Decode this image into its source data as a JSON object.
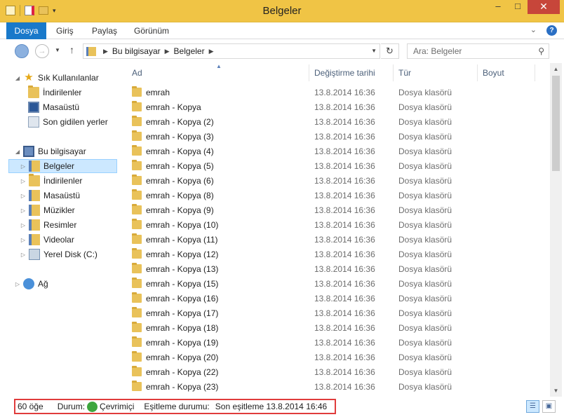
{
  "window": {
    "title": "Belgeler",
    "minimize": "–",
    "maximize": "□",
    "close": "✕"
  },
  "ribbon": {
    "tabs": [
      "Dosya",
      "Giriş",
      "Paylaş",
      "Görünüm"
    ]
  },
  "address": {
    "crumbs": [
      "Bu bilgisayar",
      "Belgeler"
    ],
    "search_placeholder": "Ara: Belgeler"
  },
  "nav": {
    "favorites_label": "Sık Kullanılanlar",
    "favorites": [
      "İndirilenler",
      "Masaüstü",
      "Son gidilen yerler"
    ],
    "pc_label": "Bu bilgisayar",
    "pc_items": [
      "Belgeler",
      "İndirilenler",
      "Masaüstü",
      "Müzikler",
      "Resimler",
      "Videolar",
      "Yerel Disk (C:)"
    ],
    "network_label": "Ağ",
    "selected": "Belgeler"
  },
  "columns": {
    "name": "Ad",
    "date": "Değiştirme tarihi",
    "type": "Tür",
    "size": "Boyut"
  },
  "files": [
    {
      "name": "emrah",
      "date": "13.8.2014 16:36",
      "type": "Dosya klasörü"
    },
    {
      "name": "emrah - Kopya",
      "date": "13.8.2014 16:36",
      "type": "Dosya klasörü"
    },
    {
      "name": "emrah - Kopya (2)",
      "date": "13.8.2014 16:36",
      "type": "Dosya klasörü"
    },
    {
      "name": "emrah - Kopya (3)",
      "date": "13.8.2014 16:36",
      "type": "Dosya klasörü"
    },
    {
      "name": "emrah - Kopya (4)",
      "date": "13.8.2014 16:36",
      "type": "Dosya klasörü"
    },
    {
      "name": "emrah - Kopya (5)",
      "date": "13.8.2014 16:36",
      "type": "Dosya klasörü"
    },
    {
      "name": "emrah - Kopya (6)",
      "date": "13.8.2014 16:36",
      "type": "Dosya klasörü"
    },
    {
      "name": "emrah - Kopya (8)",
      "date": "13.8.2014 16:36",
      "type": "Dosya klasörü"
    },
    {
      "name": "emrah - Kopya (9)",
      "date": "13.8.2014 16:36",
      "type": "Dosya klasörü"
    },
    {
      "name": "emrah - Kopya (10)",
      "date": "13.8.2014 16:36",
      "type": "Dosya klasörü"
    },
    {
      "name": "emrah - Kopya (11)",
      "date": "13.8.2014 16:36",
      "type": "Dosya klasörü"
    },
    {
      "name": "emrah - Kopya (12)",
      "date": "13.8.2014 16:36",
      "type": "Dosya klasörü"
    },
    {
      "name": "emrah - Kopya (13)",
      "date": "13.8.2014 16:36",
      "type": "Dosya klasörü"
    },
    {
      "name": "emrah - Kopya (15)",
      "date": "13.8.2014 16:36",
      "type": "Dosya klasörü"
    },
    {
      "name": "emrah - Kopya (16)",
      "date": "13.8.2014 16:36",
      "type": "Dosya klasörü"
    },
    {
      "name": "emrah - Kopya (17)",
      "date": "13.8.2014 16:36",
      "type": "Dosya klasörü"
    },
    {
      "name": "emrah - Kopya (18)",
      "date": "13.8.2014 16:36",
      "type": "Dosya klasörü"
    },
    {
      "name": "emrah - Kopya (19)",
      "date": "13.8.2014 16:36",
      "type": "Dosya klasörü"
    },
    {
      "name": "emrah - Kopya (20)",
      "date": "13.8.2014 16:36",
      "type": "Dosya klasörü"
    },
    {
      "name": "emrah - Kopya (22)",
      "date": "13.8.2014 16:36",
      "type": "Dosya klasörü"
    },
    {
      "name": "emrah - Kopya (23)",
      "date": "13.8.2014 16:36",
      "type": "Dosya klasörü"
    }
  ],
  "status": {
    "count": "60 öğe",
    "state_label": "Durum:",
    "state_value": "Çevrimiçi",
    "sync_label": "Eşitleme durumu:",
    "sync_value": "Son eşitleme 13.8.2014 16:46"
  },
  "colors": {
    "titlebar": "#f0c445",
    "file_tab": "#1979ca",
    "close_button": "#c7463a",
    "highlight_border": "#e03c3c",
    "selection": "#cce8ff"
  }
}
